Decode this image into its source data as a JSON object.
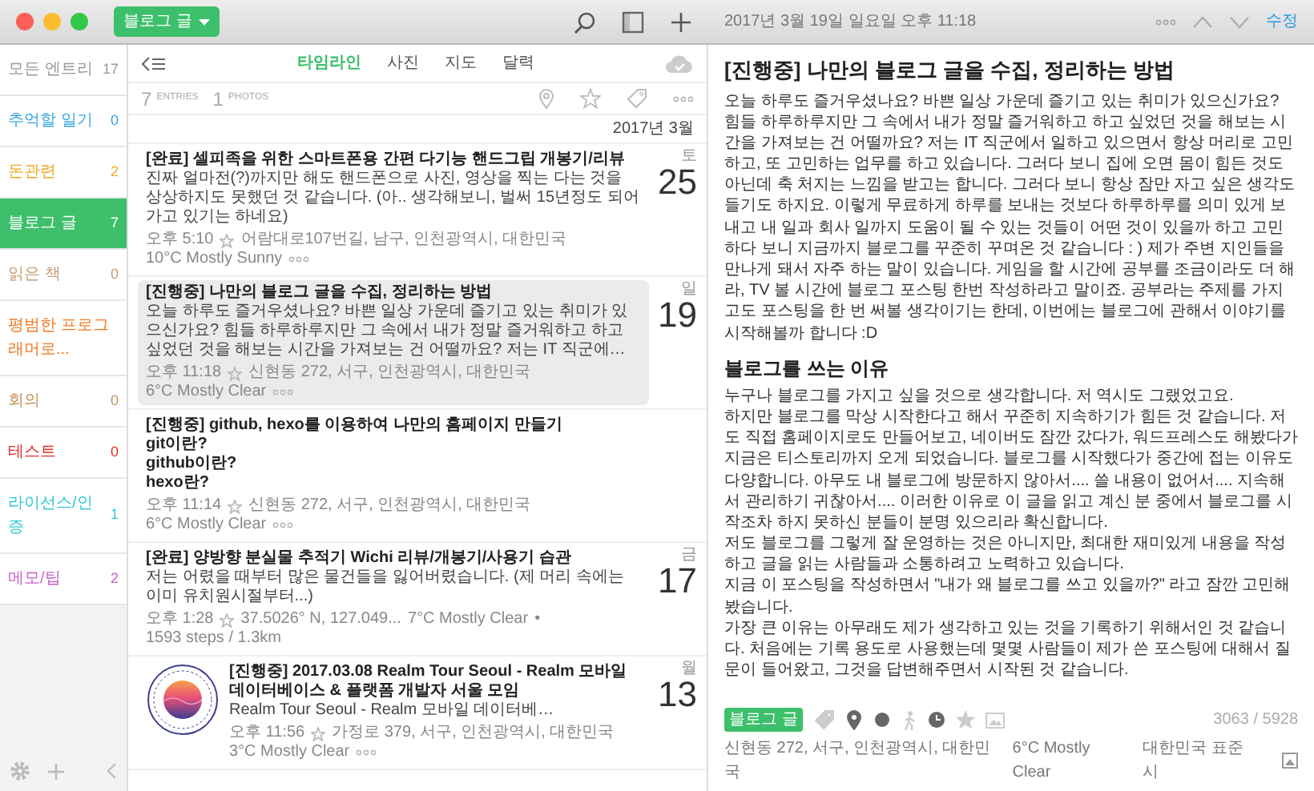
{
  "toolbar": {
    "notebook": "블로그 글",
    "date": "2017년 3월 19일 일요일 오후 11:18",
    "edit": "수정"
  },
  "sidebar": {
    "items": [
      {
        "label": "모든 엔트리",
        "count": "17",
        "color": "#999999",
        "selected": false
      },
      {
        "label": "추억할 일기",
        "count": "0",
        "color": "#3aa6e2",
        "selected": false
      },
      {
        "label": "돈관련",
        "count": "2",
        "color": "#f2a922",
        "selected": false
      },
      {
        "label": "블로그 글",
        "count": "7",
        "color": "#3dbf6b",
        "selected": true
      },
      {
        "label": "읽은 책",
        "count": "0",
        "color": "#c89b74",
        "selected": false
      },
      {
        "label": "평범한 프로그래머로...",
        "color": "#f27a22",
        "selected": false
      },
      {
        "label": "회의",
        "count": "0",
        "color": "#c8905a",
        "selected": false
      },
      {
        "label": "테스트",
        "count": "0",
        "color": "#e3302a",
        "selected": false
      },
      {
        "label": "라이선스/인증",
        "count": "1",
        "color": "#2fc8d8",
        "selected": false
      },
      {
        "label": "메모/팁",
        "count": "2",
        "color": "#c864c8",
        "selected": false
      }
    ]
  },
  "list": {
    "tabs": [
      {
        "label": "타임라인",
        "selected": true
      },
      {
        "label": "사진",
        "selected": false
      },
      {
        "label": "지도",
        "selected": false
      },
      {
        "label": "달력",
        "selected": false
      }
    ],
    "entries_count": "7",
    "entries_label": "ENTRIES",
    "photos_count": "1",
    "photos_label": "PHOTOS",
    "month": "2017년 3월",
    "entries": [
      {
        "kind": "text",
        "selected": false,
        "title": "[완료] 셀피족을 위한 스마트폰용 간편 다기능 핸드그립 개봉기/리뷰",
        "body": [
          "진짜 얼마전(?)까지만 해도 핸드폰으로 사진, 영상을 찍는 다는 것을 상상하지도 못했던 것 같습니다. (아.. 생각해보니, 벌써 15년정도 되어가고 있기는 하네요)"
        ],
        "time": "오후 5:10",
        "meta": [
          "어람대로107번길, 남구, 인천광역시, 대한민국",
          "10°C Mostly Sunny"
        ],
        "more": true,
        "weekday": "토",
        "day": "25"
      },
      {
        "kind": "text",
        "selected": true,
        "title": "[진행중] 나만의 블로그 글을 수집, 정리하는 방법",
        "body": [
          "오늘 하루도 즐거우셨나요? 바쁜 일상 가운데 즐기고 있는 취미가 있으신가요? 힘들 하루하루지만 그 속에서 내가 정말 즐거워하고 하고 싶었던 것을 해보는 시간을 가져보는 건 어떨까요? 저는 IT 직군에…"
        ],
        "time": "오후 11:18",
        "meta": [
          "신현동 272, 서구, 인천광역시, 대한민국",
          "6°C Mostly Clear"
        ],
        "more": true,
        "weekday": "일",
        "day": "19"
      },
      {
        "kind": "text",
        "selected": false,
        "title": "[진행중] github, hexo를 이용하여 나만의 홈페이지 만들기",
        "body": [
          "git이란?",
          "github이란?",
          "hexo란?"
        ],
        "time": "오후 11:14",
        "meta": [
          "신현동 272, 서구, 인천광역시, 대한민국",
          "6°C Mostly Clear"
        ],
        "more": true
      },
      {
        "kind": "text",
        "selected": false,
        "title": "[완료] 양방향 분실물 추적기 Wichi 리뷰/개봉기/사용기 습관",
        "body": [
          "저는 어렸을 때부터 많은 물건들을 잃어버렸습니다. (제 머리 속에는 이미 유치원시절부터...)"
        ],
        "time": "오후 1:28",
        "meta": [
          "37.5026° N, 127.049...",
          "7°C Mostly Clear",
          "•",
          "1593 steps / 1.3km"
        ],
        "more": false,
        "weekday": "금",
        "day": "17"
      },
      {
        "kind": "image",
        "selected": false,
        "title": "[진행중] 2017.03.08 Realm Tour Seoul - Realm 모바일 데이터베이스 & 플랫폼 개발자 서울 모임",
        "body": [
          "Realm Tour Seoul - Realm 모바일 데이터베…"
        ],
        "time": "오후 11:56",
        "meta": [
          "가정로 379, 서구, 인천광역시, 대한민국",
          "3°C Mostly Clear"
        ],
        "more": true,
        "weekday": "월",
        "day": "13"
      }
    ]
  },
  "detail": {
    "title": "[진행중] 나만의 블로그 글을 수집, 정리하는 방법",
    "paragraphs": [
      "오늘 하루도 즐거우셨나요? 바쁜 일상 가운데 즐기고 있는 취미가 있으신가요? 힘들 하루하루지만 그 속에서 내가 정말 즐거워하고 하고 싶었던 것을 해보는 시간을 가져보는 건 어떨까요? 저는 IT 직군에서 일하고 있으면서 항상 머리로 고민하고, 또 고민하는 업무를 하고 있습니다. 그러다 보니 집에 오면 몸이 힘든 것도 아닌데 축 처지는 느낌을 받고는 합니다. 그러다 보니 항상 잠만 자고 싶은 생각도 들기도 하지요. 이렇게 무료하게 하루를 보내는 것보다 하루하루를 의미 있게 보내고 내 일과 회사 일까지 도움이 될 수 있는 것들이 어떤 것이 있을까 하고 고민하다 보니 지금까지 블로그를 꾸준히 꾸며온 것 같습니다 : ) 제가 주변 지인들을 만나게 돼서 자주 하는 말이 있습니다. 게임을 할 시간에 공부를 조금이라도 더 해라, TV 볼 시간에 블로그 포스팅 한번 작성하라고 말이죠. 공부라는 주제를 가지고도 포스팅을 한 번 써볼 생각이기는 한데, 이번에는 블로그에 관해서 이야기를 시작해볼까 합니다 :D"
    ],
    "heading": "블로그를 쓰는 이유",
    "lines": [
      "누구나 블로그를 가지고 싶을 것으로 생각합니다. 저 역시도 그랬었고요.",
      "하지만 블로그를 막상 시작한다고 해서 꾸준히 지속하기가 힘든 것 같습니다. 저도 직접 홈페이지로도 만들어보고, 네이버도 잠깐 갔다가, 워드프레스도 해봤다가 지금은 티스토리까지 오게 되었습니다. 블로그를 시작했다가 중간에 접는 이유도 다양합니다. 아무도 내 블로그에 방문하지 않아서.... 쓸 내용이 없어서.... 지속해서 관리하기 귀찮아서.... 이러한 이유로 이 글을 읽고 계신 분 중에서 블로그를 시작조차 하지 못하신 분들이 분명 있으리라 확신합니다.",
      "저도 블로그를 그렇게 잘 운영하는 것은 아니지만, 최대한 재미있게 내용을 작성하고 글을 읽는 사람들과 소통하려고 노력하고 있습니다.",
      "지금 이 포스팅을 작성하면서 \"내가 왜 블로그를 쓰고 있을까?\" 라고 잠깐 고민해봤습니다.",
      "가장 큰 이유는 아무래도 제가 생각하고 있는 것을 기록하기 위해서인 것 같습니다. 처음에는 기록 용도로 사용했는데 몇몇 사람들이 제가 쓴 포스팅에 대해서 질문이 들어왔고, 그것을 답변해주면서 시작된 것 같습니다."
    ],
    "tag": "블로그 글",
    "count": "3063 / 5928",
    "meta": [
      "신현동 272, 서구, 인천광역시, 대한민국",
      "6°C Mostly Clear",
      "대한민국 표준시"
    ]
  }
}
